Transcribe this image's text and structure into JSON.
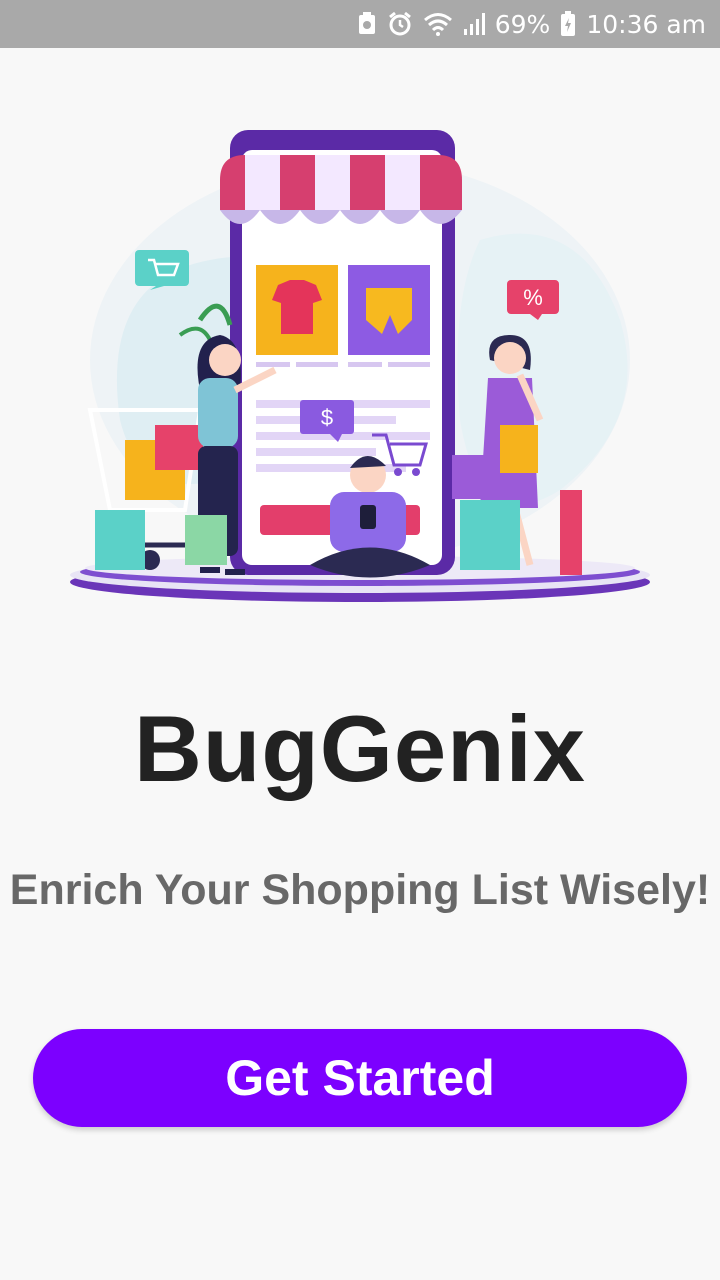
{
  "status_bar": {
    "battery_percent": "69%",
    "time": "10:36 am",
    "icons": [
      "storage-icon",
      "alarm-icon",
      "wifi-icon",
      "signal-icon",
      "battery-icon"
    ]
  },
  "hero": {
    "price_tag": "$",
    "discount_tag": "%",
    "icon": "shopping-illustration"
  },
  "app": {
    "title": "BugGenix",
    "tagline": "Enrich Your Shopping List Wisely!"
  },
  "cta": {
    "label": "Get Started",
    "color": "#7c00ff"
  }
}
